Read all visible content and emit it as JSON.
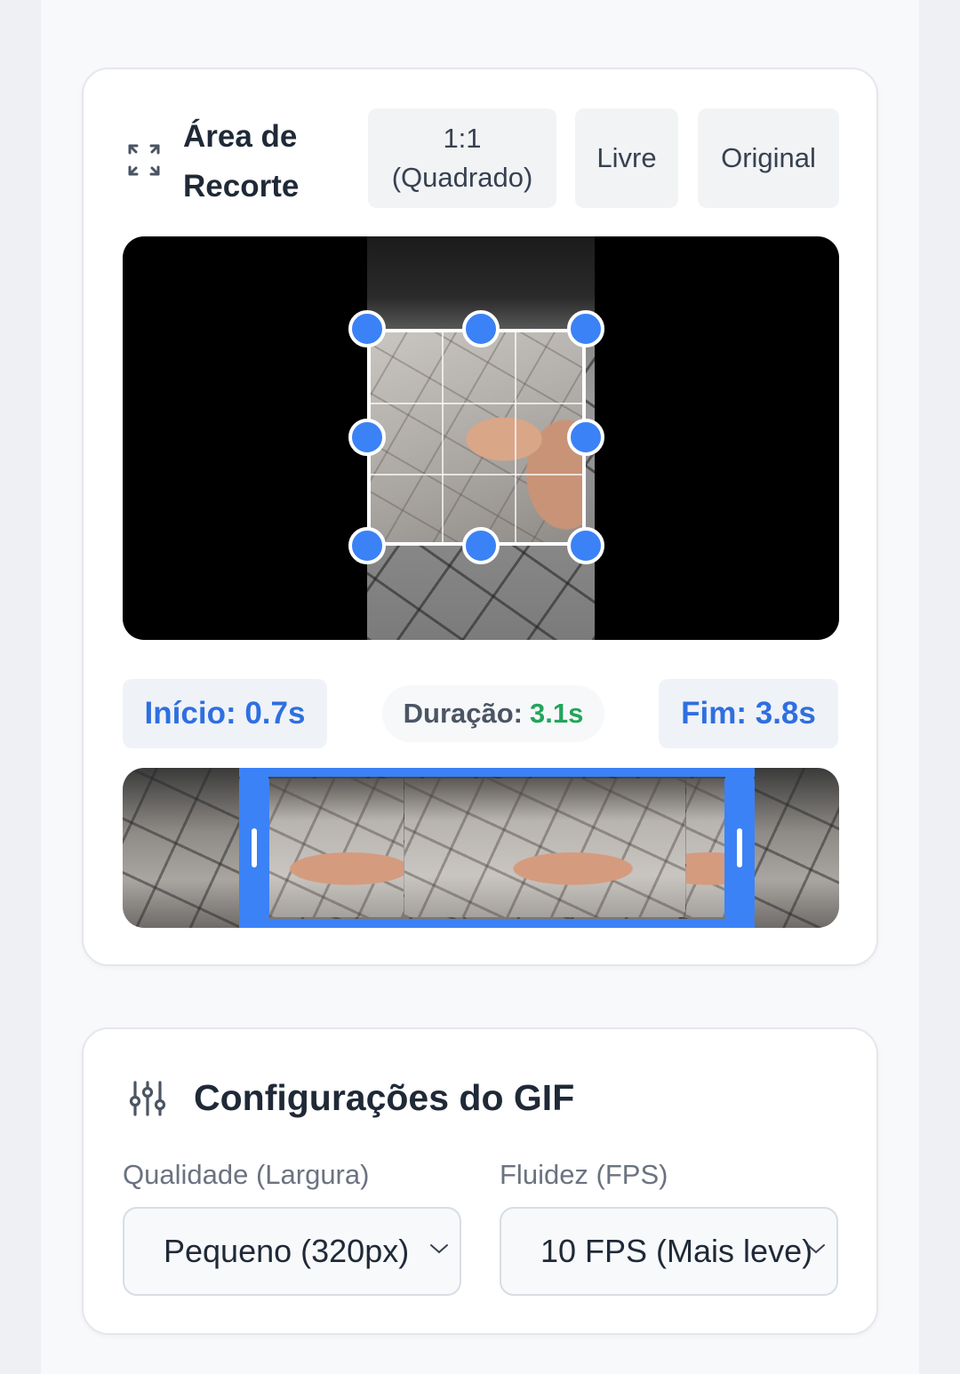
{
  "crop": {
    "title": "Área de Recorte",
    "icon": "expand-corners-icon",
    "ratio_buttons": [
      {
        "label": "1:1\n(Quadrado)"
      },
      {
        "label": "Livre"
      },
      {
        "label": "Original"
      }
    ]
  },
  "trim": {
    "start_label": "Início: 0.7s",
    "duration_label": "Duração:",
    "duration_value": "3.1s",
    "end_label": "Fim: 3.8s"
  },
  "gif_settings": {
    "title": "Configurações do GIF",
    "icon": "sliders-icon",
    "quality_label": "Qualidade (Largura)",
    "quality_value": "Pequeno (320px)",
    "fps_label": "Fluidez (FPS)",
    "fps_value": "10 FPS (Mais leve)"
  },
  "colors": {
    "accent": "#3b82f6",
    "duration_green": "#22a55b"
  }
}
